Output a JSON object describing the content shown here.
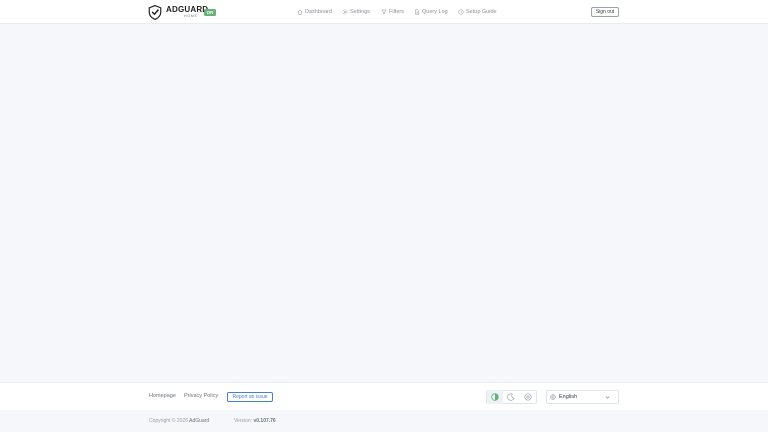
{
  "header": {
    "logo_word": "ADGUARD",
    "logo_sub": "HOME",
    "badge": "ON",
    "nav": [
      {
        "label": "Dashboard",
        "icon": "home-icon"
      },
      {
        "label": "Settings",
        "icon": "gear-icon"
      },
      {
        "label": "Filters",
        "icon": "filter-icon"
      },
      {
        "label": "Query Log",
        "icon": "document-icon"
      },
      {
        "label": "Setup Guide",
        "icon": "setup-icon"
      }
    ],
    "signout_label": "Sign out"
  },
  "footer": {
    "homepage": "Homepage",
    "privacy": "Privacy Policy",
    "report": "Report an issue",
    "language": "English",
    "theme_buttons": [
      {
        "icon": "auto-theme-icon",
        "active": true
      },
      {
        "icon": "moon-icon",
        "active": false
      },
      {
        "icon": "sun-icon",
        "active": false
      }
    ]
  },
  "bottom": {
    "copyright_prefix": "Copyright © 2026",
    "copyright_owner": "AdGuard",
    "version_label": "Version:",
    "version": "v0.107.76"
  },
  "colors": {
    "accent": "#67b279",
    "link": "#467fcf",
    "background": "#f5f7fb"
  }
}
